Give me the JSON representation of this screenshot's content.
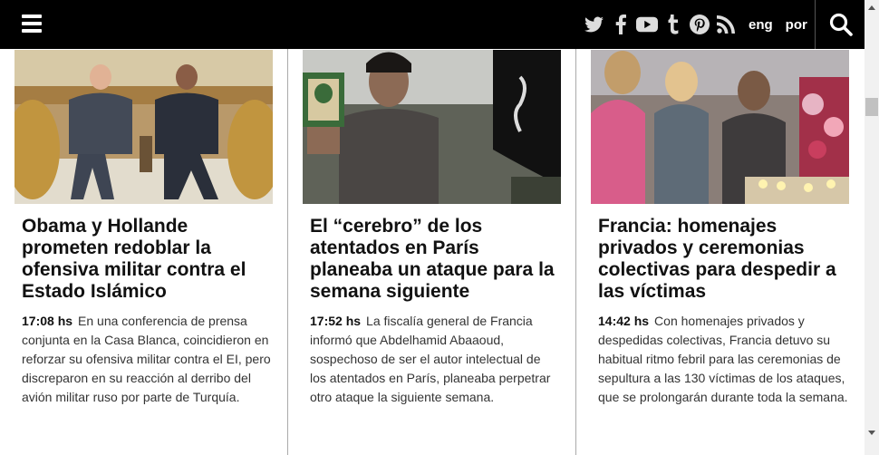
{
  "header": {
    "languages": [
      "eng",
      "por"
    ],
    "social_icons": [
      "twitter-icon",
      "facebook-icon",
      "youtube-icon",
      "tumblr-icon",
      "pinterest-icon",
      "rss-icon"
    ]
  },
  "articles": [
    {
      "headline": "Obama y Hollande prometen redoblar la ofensiva militar contra el Estado Islámico",
      "time": "17:08 hs",
      "summary": "En una conferencia de prensa conjunta en la Casa Blanca, coincidieron en reforzar su ofensiva militar contra el EI, pero discreparon en su reacción al derribo del avión militar ruso por parte de Turquía."
    },
    {
      "headline": "El “cerebro” de los atentados en París planeaba un ataque para la semana siguiente",
      "time": "17:52 hs",
      "summary": "La fiscalía general de Francia informó que Abdelhamid Abaaoud, sospechoso de ser el autor intelectual de los atentados en París, planeaba perpetrar otro ataque la siguiente semana."
    },
    {
      "headline": "Francia: homenajes privados y ceremonias colectivas para despedir a las víctimas",
      "time": "14:42 hs",
      "summary": "Con homenajes privados y despedidas colectivas, Francia detuvo su habitual ritmo febril para las ceremonias de sepultura a las 130 víctimas de los ataques, que se prolongarán durante toda la semana."
    }
  ]
}
